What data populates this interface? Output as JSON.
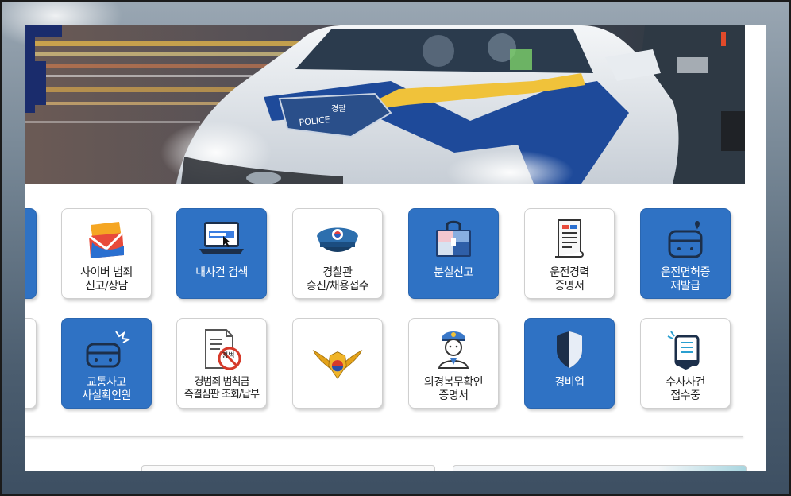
{
  "tiles": [
    {
      "id": "cyber",
      "lines": [
        "사이버 범죄",
        "신고/상담"
      ],
      "style": "white",
      "icon": "cyber-envelope-icon"
    },
    {
      "id": "mycase",
      "lines": [
        "내사건 검색"
      ],
      "style": "blue",
      "icon": "laptop-search-icon"
    },
    {
      "id": "recruit",
      "lines": [
        "경찰관",
        "승진/채용접수"
      ],
      "style": "white",
      "icon": "police-cap-icon"
    },
    {
      "id": "lost",
      "lines": [
        "분실신고"
      ],
      "style": "blue",
      "icon": "lost-bag-icon"
    },
    {
      "id": "drivecert",
      "lines": [
        "운전경력",
        "증명서"
      ],
      "style": "white",
      "icon": "document-scroll-icon"
    },
    {
      "id": "license",
      "lines": [
        "운전면허증",
        "재발급"
      ],
      "style": "blue",
      "icon": "license-card-icon"
    },
    {
      "id": "traffic",
      "lines": [
        "교통사고",
        "사실확인원"
      ],
      "style": "blue",
      "icon": "car-crash-icon"
    },
    {
      "id": "fine",
      "lines": [
        "경범죄 범칙금",
        "즉결심판 조회/납부"
      ],
      "style": "white",
      "icon": "fine-document-icon",
      "stamp": "경범"
    },
    {
      "id": "emblem",
      "lines": [],
      "style": "white",
      "icon": "police-emblem-icon"
    },
    {
      "id": "conscript",
      "lines": [
        "의경복무확인",
        "증명서"
      ],
      "style": "white",
      "icon": "officer-avatar-icon"
    },
    {
      "id": "security",
      "lines": [
        "경비업"
      ],
      "style": "blue",
      "icon": "shield-icon"
    },
    {
      "id": "casereceipt",
      "lines": [
        "수사사건",
        "접수중"
      ],
      "style": "white",
      "icon": "case-document-icon"
    }
  ],
  "banner": {
    "car_text": "POLICE",
    "car_text2": "경찰"
  },
  "colors": {
    "tile_blue": "#2f72c4",
    "tile_white": "#ffffff",
    "banner_dark": "#2b3642"
  }
}
